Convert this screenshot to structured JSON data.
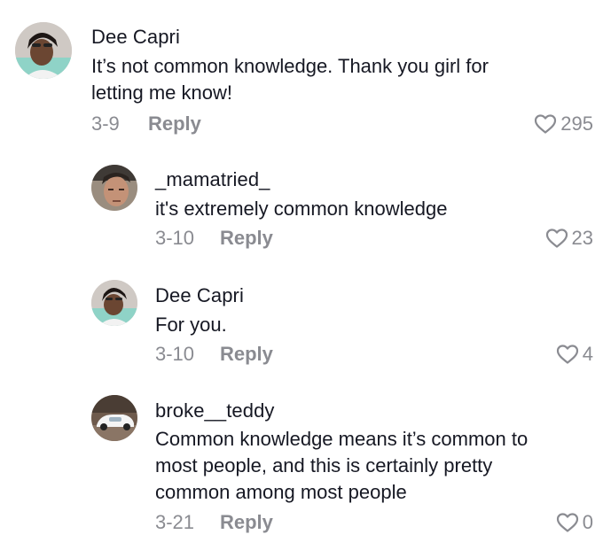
{
  "comments": [
    {
      "username": "Dee Capri",
      "lines": [
        "It’s not common knowledge. Thank you girl for",
        "letting me know!"
      ],
      "date": "3-9",
      "reply_label": "Reply",
      "likes": "295",
      "avatar_icon": "profile-photo"
    },
    {
      "username": "_mamatried_",
      "lines": [
        "it's extremely common knowledge"
      ],
      "date": "3-10",
      "reply_label": "Reply",
      "likes": "23",
      "avatar_icon": "profile-photo"
    },
    {
      "username": "Dee Capri",
      "lines": [
        "For you."
      ],
      "date": "3-10",
      "reply_label": "Reply",
      "likes": "4",
      "avatar_icon": "profile-photo"
    },
    {
      "username": "broke__teddy",
      "lines": [
        "Common knowledge means it’s common to",
        "most people, and this is certainly pretty",
        "common among most people"
      ],
      "date": "3-21",
      "reply_label": "Reply",
      "likes": "0",
      "avatar_icon": "profile-photo"
    }
  ],
  "colors": {
    "text": "#161823",
    "secondary": "#8a8b91"
  },
  "icons": {
    "like": "heart-outline-icon"
  }
}
